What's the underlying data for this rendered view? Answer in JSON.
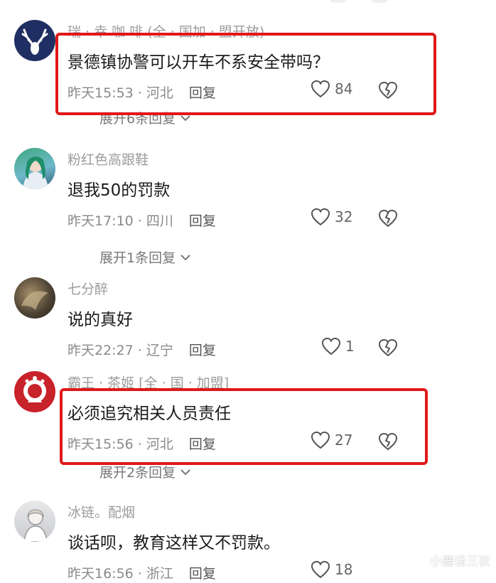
{
  "comments": [
    {
      "username": "瑞 · 幸 咖 啡 (全 · 国加 · 盟开放)",
      "text": "景德镇协警可以开车不系安全带吗？",
      "time": "昨天15:53",
      "location": "河北",
      "reply_label": "回复",
      "likes": "84",
      "expand": "展开6条回复"
    },
    {
      "username": "粉红色高跟鞋",
      "text": "退我50的罚款",
      "time": "昨天17:10",
      "location": "四川",
      "reply_label": "回复",
      "likes": "32",
      "expand": "展开1条回复"
    },
    {
      "username": "七分醉",
      "text": "说的真好",
      "time": "昨天22:27",
      "location": "辽宁",
      "reply_label": "回复",
      "likes": "1",
      "expand": ""
    },
    {
      "username": "霸王 · 茶姬 [全 · 国 · 加盟]",
      "text": "必须追究相关人员责任",
      "time": "昨天15:56",
      "location": "河北",
      "reply_label": "回复",
      "likes": "27",
      "expand": "展开2条回复"
    },
    {
      "username": "冰链。配烟",
      "text": "谈话呗，教育这样又不罚款。",
      "time": "昨天16:56",
      "location": "浙江",
      "reply_label": "回复",
      "likes": "18",
      "expand": ""
    }
  ],
  "meta_separator": "·",
  "watermark": "小鹿话三农",
  "colors": {
    "highlight_box": "#e01818",
    "text": "#1a1a1a",
    "muted": "#9c9c9c"
  },
  "icons": {
    "like": "heart-outline-icon",
    "dislike": "broken-heart-icon",
    "expand": "chevron-down-icon"
  }
}
